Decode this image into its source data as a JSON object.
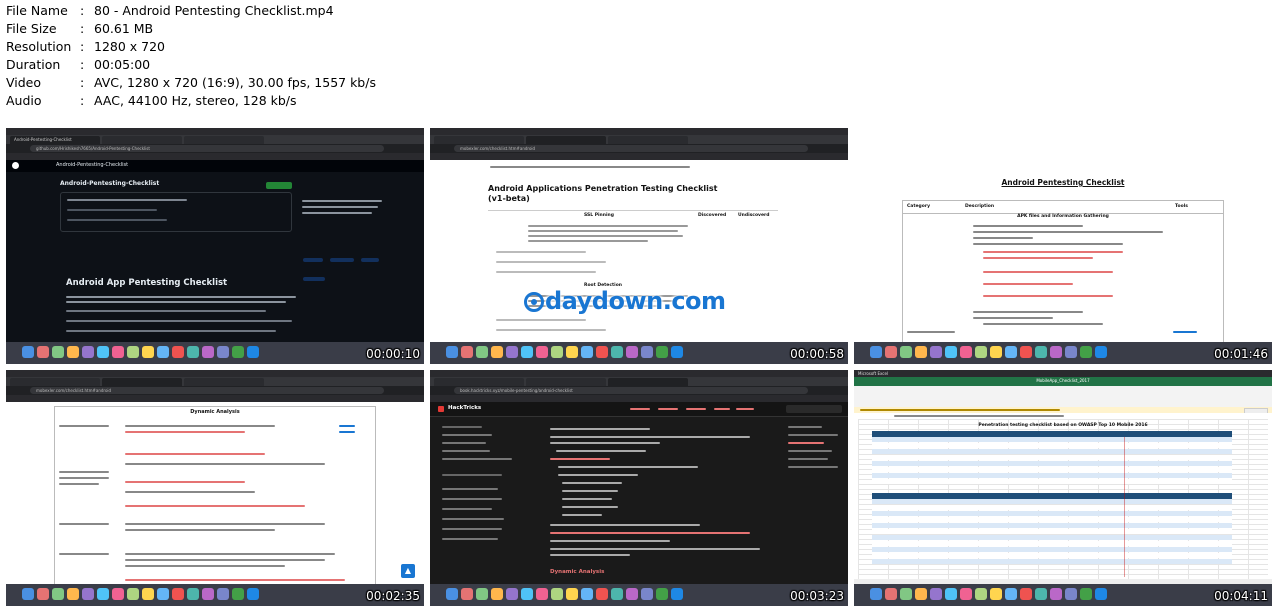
{
  "metadata": [
    {
      "key": "File Name",
      "sep": ":",
      "value": "80 - Android Pentesting Checklist.mp4"
    },
    {
      "key": "File Size",
      "sep": ":",
      "value": "60.61 MB"
    },
    {
      "key": "Resolution",
      "sep": ":",
      "value": "1280 x 720"
    },
    {
      "key": "Duration",
      "sep": ":",
      "value": "00:05:00"
    },
    {
      "key": "Video",
      "sep": ":",
      "value": "AVC, 1280 x 720 (16:9), 30.00 fps, 1557 kb/s"
    },
    {
      "key": "Audio",
      "sep": ":",
      "value": "AAC, 44100 Hz, stereo, 128 kb/s"
    }
  ],
  "thumbnails": [
    {
      "timestamp": "00:00:10",
      "theme": "dark",
      "heading": "Android App Pentesting Checklist",
      "repo": "Android-Pentesting-Checklist",
      "url": "github.com/Hrishikesh7665/Android-Pentesting-Checklist"
    },
    {
      "timestamp": "00:00:58",
      "theme": "light",
      "heading": "Android Applications Penetration Testing Checklist (v1-beta)",
      "url": "mobexler.com/checklist.htm#android",
      "col_ssl": "SSL Pinning",
      "col_root": "Root Detection",
      "col_disc": "Discovered",
      "col_undisc": "Undiscoverd"
    },
    {
      "timestamp": "00:01:46",
      "theme": "white",
      "heading": "Android Pentesting Checklist",
      "section": "APK files and Information Gathering",
      "col_category": "Category",
      "col_description": "Description",
      "col_tools": "Tools"
    },
    {
      "timestamp": "00:02:35",
      "theme": "white",
      "heading": "Dynamic Analysis",
      "url": "mobexler.com/checklist.htm#android"
    },
    {
      "timestamp": "00:03:23",
      "theme": "dark",
      "heading": "HackTricks",
      "url": "book.hacktricks.xyz/mobile-pentesting/android-checklist",
      "bottom_title": "Dynamic Analysis"
    },
    {
      "timestamp": "00:04:11",
      "theme": "excel",
      "heading": "Penetration testing checklist based on OWASP Top 10 Mobile 2016",
      "app": "Microsoft Excel",
      "file": "MobileApp_Checklist_2017"
    }
  ],
  "watermark": {
    "text": "daydown.com",
    "color": "#1976d2"
  },
  "colors": {
    "dark_bg": "#0d1117",
    "dock": "#3a3d48",
    "accent": "#1976d2"
  }
}
